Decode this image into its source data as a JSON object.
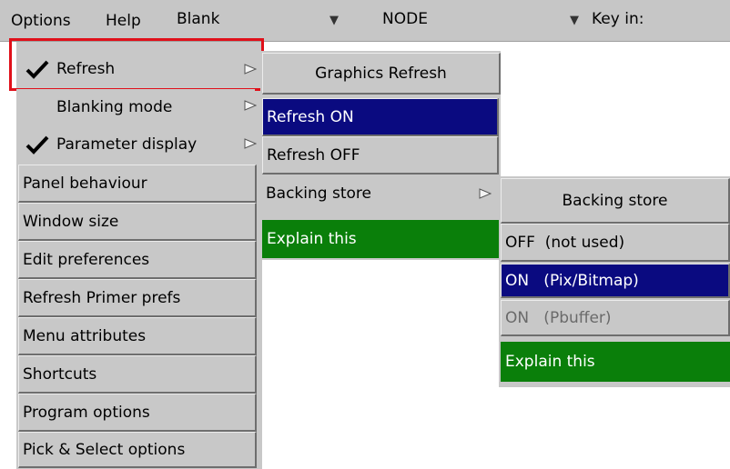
{
  "menubar": {
    "options_label": "Options",
    "help_label": "Help",
    "blank_field": "Blank",
    "node_field": "NODE",
    "keyin_field": "Key in:"
  },
  "options_menu": {
    "items": [
      {
        "label": "Refresh",
        "checked": true,
        "submenu": true,
        "highlighted": true
      },
      {
        "label": "Blanking mode",
        "checked": false,
        "submenu": true
      },
      {
        "label": "Parameter display",
        "checked": true,
        "submenu": true
      },
      {
        "label": "Panel behaviour"
      },
      {
        "label": "Window size"
      },
      {
        "label": "Edit preferences"
      },
      {
        "label": "Refresh Primer prefs"
      },
      {
        "label": "Menu attributes"
      },
      {
        "label": "Shortcuts"
      },
      {
        "label": "Program options"
      },
      {
        "label": "Pick & Select options"
      }
    ]
  },
  "graphics_refresh_menu": {
    "title": "Graphics Refresh",
    "items": [
      {
        "label": "Refresh ON",
        "state": "selected"
      },
      {
        "label": "Refresh OFF",
        "state": "normal"
      },
      {
        "label": "Backing store",
        "state": "submenu"
      },
      {
        "label": "Explain this",
        "state": "explain"
      }
    ]
  },
  "backing_store_menu": {
    "title": "Backing store",
    "items": [
      {
        "label": "OFF  (not used)",
        "state": "normal"
      },
      {
        "label": "ON   (Pix/Bitmap)",
        "state": "selected"
      },
      {
        "label": "ON   (Pbuffer)",
        "state": "disabled"
      },
      {
        "label": "Explain this",
        "state": "explain"
      }
    ]
  },
  "colors": {
    "selected": "#0a0a80",
    "explain": "#0a7f0a",
    "highlight_box": "#e0101a",
    "menu_bg": "#c8c8c8"
  }
}
